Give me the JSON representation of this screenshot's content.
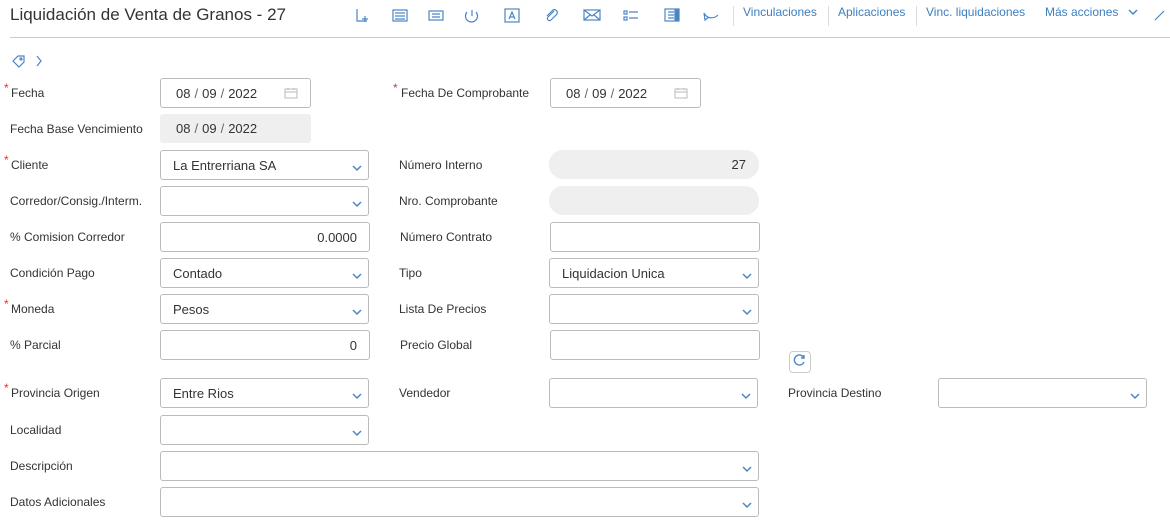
{
  "header": {
    "title": "Liquidación de Venta de Granos - 27",
    "toolbar_icons": [
      "new-doc-icon",
      "list-icon",
      "print-icon",
      "clock-icon",
      "text-a-icon",
      "attachment-icon",
      "email-icon",
      "list-bullets-icon",
      "panel-icon",
      "comment-icon"
    ],
    "links": [
      "Vinculaciones",
      "Aplicaciones",
      "Vinc. liquidaciones",
      "Más acciones"
    ]
  },
  "form": {
    "fecha": {
      "label": "Fecha",
      "dd": "08",
      "mm": "09",
      "yyyy": "2022"
    },
    "fecha_comprobante": {
      "label": "Fecha De Comprobante",
      "dd": "08",
      "mm": "09",
      "yyyy": "2022"
    },
    "fecha_base": {
      "label": "Fecha Base Vencimiento",
      "dd": "08",
      "mm": "09",
      "yyyy": "2022"
    },
    "cliente": {
      "label": "Cliente",
      "value": "La Entrerriana SA"
    },
    "numero_interno": {
      "label": "Número Interno",
      "value": "27"
    },
    "corredor": {
      "label": "Corredor/Consig./Interm.",
      "value": ""
    },
    "nro_comprobante": {
      "label": "Nro. Comprobante",
      "value": ""
    },
    "comision": {
      "label": "% Comision Corredor",
      "value": "0.0000"
    },
    "numero_contrato": {
      "label": "Número Contrato",
      "value": ""
    },
    "condicion_pago": {
      "label": "Condición Pago",
      "value": "Contado"
    },
    "tipo": {
      "label": "Tipo",
      "value": "Liquidacion Unica"
    },
    "moneda": {
      "label": "Moneda",
      "value": "Pesos"
    },
    "lista_precios": {
      "label": "Lista De Precios",
      "value": ""
    },
    "parcial": {
      "label": "% Parcial",
      "value": "0"
    },
    "precio_global": {
      "label": "Precio Global",
      "value": ""
    },
    "provincia_origen": {
      "label": "Provincia Origen",
      "value": "Entre Rios"
    },
    "vendedor": {
      "label": "Vendedor",
      "value": ""
    },
    "provincia_destino": {
      "label": "Provincia Destino",
      "value": ""
    },
    "localidad": {
      "label": "Localidad",
      "value": ""
    },
    "descripcion": {
      "label": "Descripción",
      "value": ""
    },
    "datos_adicionales": {
      "label": "Datos Adicionales",
      "value": ""
    }
  },
  "required_mark": "*"
}
